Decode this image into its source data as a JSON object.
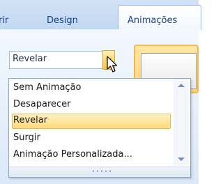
{
  "ribbon": {
    "tabs": [
      {
        "label": "rir"
      },
      {
        "label": "Design"
      },
      {
        "label": "Animações",
        "active": true
      }
    ],
    "transition_combo": {
      "value": "Revelar"
    }
  },
  "dropdown": {
    "items": [
      {
        "label": "Sem Animação",
        "selected": false
      },
      {
        "label": "Desaparecer",
        "selected": false
      },
      {
        "label": "Revelar",
        "selected": true
      },
      {
        "label": "Surgir",
        "selected": false
      },
      {
        "label": "Animação Personalizada...",
        "selected": false
      }
    ]
  },
  "colors": {
    "ribbon_text": "#15428b",
    "selection_fill": "#ffd97a",
    "selection_border": "#e7b84c"
  },
  "icons": [
    "dropdown-arrow-icon",
    "mouse-pointer-icon",
    "scroll-up-icon",
    "scroll-down-icon",
    "resize-grip-icon"
  ]
}
